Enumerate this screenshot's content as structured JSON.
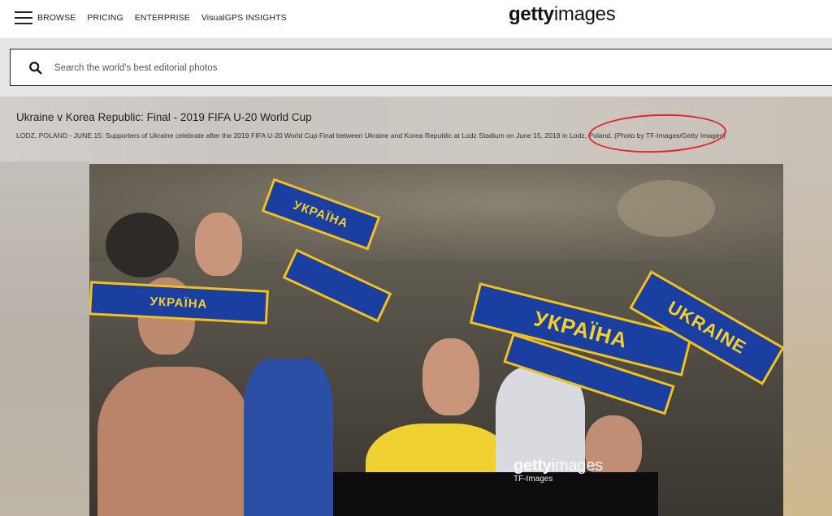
{
  "header": {
    "nav": [
      "BROWSE",
      "PRICING",
      "ENTERPRISE",
      "VisualGPS INSIGHTS"
    ],
    "logo_bold": "getty",
    "logo_light": "images"
  },
  "search": {
    "placeholder": "Search the world's best editorial photos"
  },
  "photo": {
    "title": "Ukraine v Korea Republic: Final - 2019 FIFA U-20 World Cup",
    "caption": "LODZ, POLAND - JUNE 15: Supporters of Ukraine celebrate after the 2019 FIFA U-20 World Cup Final between Ukraine and Korea Republic at Lodz Stadium on June 15, 2019 in Lodz, Poland. (Photo by TF-Images/Getty Images)",
    "scarf_texts": [
      "УКРАЇНА",
      "UKRAINE",
      "УКРАЇНА"
    ],
    "watermark_bold": "getty",
    "watermark_light": "images",
    "watermark_credit": "TF-Images"
  },
  "colors": {
    "highlight": "#e0242d",
    "scarf_blue": "#1b3fa0",
    "scarf_yellow": "#f2c21a"
  }
}
